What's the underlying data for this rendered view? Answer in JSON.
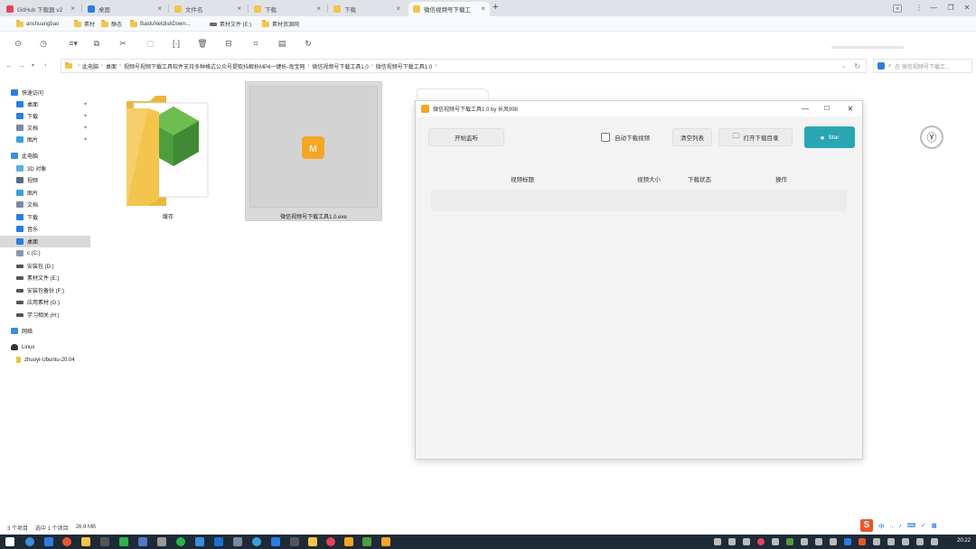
{
  "tabs": [
    {
      "label": "GitHub 下载器 v2",
      "color": "#e0445a"
    },
    {
      "label": "桌面",
      "color": "#2a7de1"
    },
    {
      "label": "文件名",
      "color": "#f3c54d"
    },
    {
      "label": "下载",
      "color": "#f3c54d"
    },
    {
      "label": "下载",
      "color": "#f3c54d"
    },
    {
      "label": "微信视频号下载工",
      "color": "#f3c54d"
    }
  ],
  "window_controls": {
    "minimize": "—",
    "restore": "❐",
    "close": "✕"
  },
  "bookmarks": [
    {
      "label": "anshuangbao",
      "type": "folder"
    },
    {
      "label": "素材",
      "type": "folder"
    },
    {
      "label": "静态",
      "type": "folder"
    },
    {
      "label": "BaiduNetdiskDown...",
      "type": "folder"
    },
    {
      "label": "素材文件 (E:)",
      "type": "drive"
    },
    {
      "label": "素材资源网",
      "type": "folder"
    }
  ],
  "toolbar_icons": [
    "new-icon",
    "clock-icon",
    "view-icon",
    "copy-icon",
    "cut-icon",
    "paste-icon",
    "rename-icon",
    "delete-icon",
    "share-icon",
    "crop-icon",
    "properties-icon",
    "refresh-icon"
  ],
  "address": {
    "crumbs": [
      "此电脑",
      "桌面",
      "视频号视频下载工具软件支持多种格式公众号提取抖解析MP4一键析-淘宝网",
      "微信视频号下载工具1.0",
      "微信视频号下载工具1.0"
    ],
    "search_placeholder": "在 微信视频号下载工..."
  },
  "sidebar": {
    "items": [
      {
        "label": "快速访问",
        "icon_color": "#2a7de1",
        "indent": 0
      },
      {
        "label": "桌面",
        "icon_color": "#2a7de1",
        "indent": 1,
        "pinned": true
      },
      {
        "label": "下载",
        "icon_color": "#2a7de1",
        "indent": 1,
        "pinned": true
      },
      {
        "label": "文档",
        "icon_color": "#7a8aa0",
        "indent": 1,
        "pinned": true
      },
      {
        "label": "图片",
        "icon_color": "#3aa0d8",
        "indent": 1,
        "pinned": true
      },
      {
        "label": "此电脑",
        "icon_color": "#3a8ee0",
        "indent": 0
      },
      {
        "label": "3D 对象",
        "icon_color": "#5bb0e0",
        "indent": 1
      },
      {
        "label": "视频",
        "icon_color": "#5a6b80",
        "indent": 1
      },
      {
        "label": "图片",
        "icon_color": "#3aa0d8",
        "indent": 1
      },
      {
        "label": "文档",
        "icon_color": "#7a8aa0",
        "indent": 1
      },
      {
        "label": "下载",
        "icon_color": "#2a7de1",
        "indent": 1
      },
      {
        "label": "音乐",
        "icon_color": "#2a7de1",
        "indent": 1
      },
      {
        "label": "桌面",
        "icon_color": "#2a7de1",
        "indent": 1,
        "selected": true
      },
      {
        "label": "c (C:)",
        "icon_color": "#8a99ab",
        "indent": 1
      },
      {
        "label": "安装包 (D:)",
        "icon_color": "#555555",
        "indent": 1
      },
      {
        "label": "素材文件 (E:)",
        "icon_color": "#555555",
        "indent": 1
      },
      {
        "label": "安装包备份 (F:)",
        "icon_color": "#555555",
        "indent": 1
      },
      {
        "label": "应用素材 (G:)",
        "icon_color": "#555555",
        "indent": 1
      },
      {
        "label": "学习相关 (H:)",
        "icon_color": "#555555",
        "indent": 1
      },
      {
        "label": "网络",
        "icon_color": "#3a8ee0",
        "indent": 0
      },
      {
        "label": "Linux",
        "icon_color": "#333333",
        "indent": 0
      },
      {
        "label": "zhuoyi-Ubuntu-20.04",
        "icon_color": "#e8c53a",
        "indent": 1
      }
    ]
  },
  "files": [
    {
      "label": "缓存",
      "icon": "folder-icon"
    },
    {
      "label": "微信视频号下载工具1.0.exe",
      "icon": "app-exe-icon"
    }
  ],
  "app": {
    "title": "微信视频号下载工具1.0 by 长风998",
    "start_label": "开始监听",
    "auto_download_label": "自动下载视频",
    "clear_label": "清空列表",
    "open_dir_label": "打开下载目录",
    "star_label": "Star",
    "columns": [
      "视频标题",
      "视频大小",
      "下载状态",
      "操作"
    ]
  },
  "status": {
    "items": "3 个项目",
    "selected": "选中 1 个项目",
    "size": "26.9 MB"
  },
  "tray": {
    "ime": "中",
    "clock": "20:22"
  },
  "colors": {
    "accent": "#2aa6b2",
    "folder": "#f3c54d",
    "taskbar": "#1e2a36",
    "app_icon_orange": "#f5a623"
  }
}
